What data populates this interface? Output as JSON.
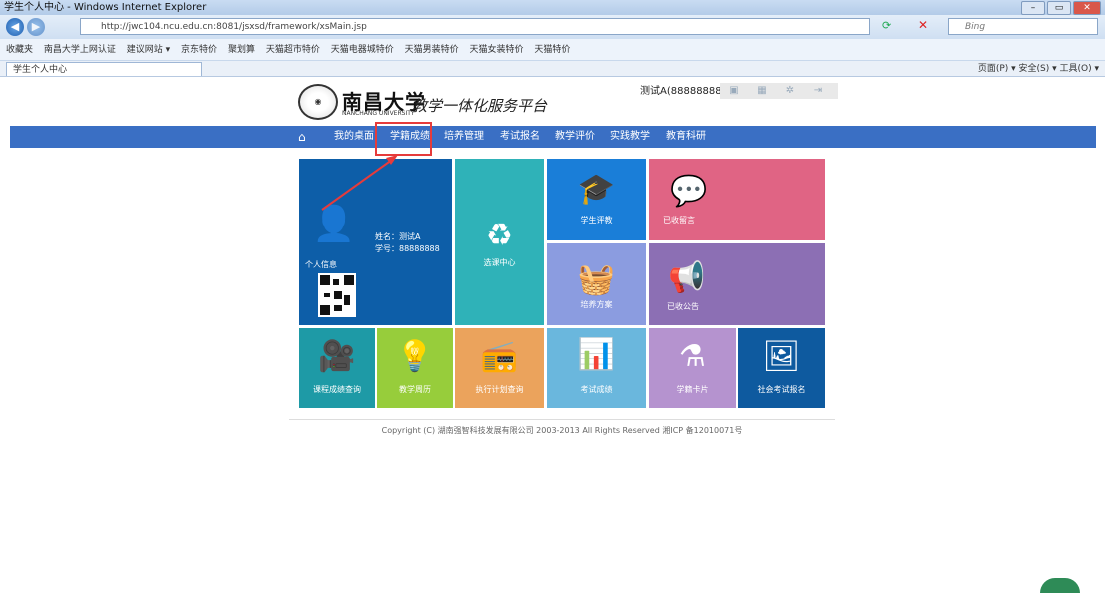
{
  "browser": {
    "title": "学生个人中心 - Windows Internet Explorer",
    "url": "http://jwc104.ncu.edu.cn:8081/jsxsd/framework/xsMain.jsp",
    "search_placeholder": "Bing",
    "favorites": [
      "收藏夹",
      "南昌大学上网认证",
      "建议网站 ▾",
      "京东特价",
      "聚划算",
      "天猫超市特价",
      "天猫电器城特价",
      "天猫男装特价",
      "天猫女装特价",
      "天猫特价"
    ],
    "tab_label": "学生个人中心",
    "command_bar": "页面(P) ▾  安全(S) ▾  工具(O) ▾"
  },
  "header": {
    "university_name": "南昌大学",
    "university_en": "NANCHANG UNIVERSITY",
    "platform_title": "教学一体化服务平台",
    "user_label": "测试A(88888888)"
  },
  "nav": {
    "home_icon": "home-icon",
    "items": [
      "我的桌面",
      "学籍成绩",
      "培养管理",
      "考试报名",
      "教学评价",
      "实践教学",
      "教育科研"
    ]
  },
  "tiles": {
    "personal_info": {
      "label": "个人信息",
      "name_line": "姓名：测试A",
      "id_line": "学号：88888888",
      "color": "#0d5ea8"
    },
    "course_center": {
      "label": "选课中心",
      "color": "#2fb2b8"
    },
    "student_eval": {
      "label": "学生评教",
      "color": "#1a7ed8"
    },
    "received_msgs": {
      "label": "已收留言",
      "color": "#e06484"
    },
    "training_plan": {
      "label": "培养方案",
      "color": "#8b9ce0"
    },
    "received_notice": {
      "label": "已收公告",
      "color": "#8c6fb4"
    },
    "course_grades": {
      "label": "课程成绩查询",
      "color": "#1e9aa6"
    },
    "teaching_calendar": {
      "label": "教学周历",
      "color": "#97cd3b"
    },
    "exec_plan": {
      "label": "执行计划查询",
      "color": "#eba35c"
    },
    "exam_grades": {
      "label": "考试成绩",
      "color": "#6ab7dd"
    },
    "status_card": {
      "label": "学籍卡片",
      "color": "#b593cf"
    },
    "social_exam": {
      "label": "社会考试报名",
      "color": "#0e5a9f"
    }
  },
  "footer": {
    "copyright": "Copyright (C) 湖南强智科技发展有限公司 2003-2013 All Rights Reserved 湘ICP 备12010071号"
  }
}
